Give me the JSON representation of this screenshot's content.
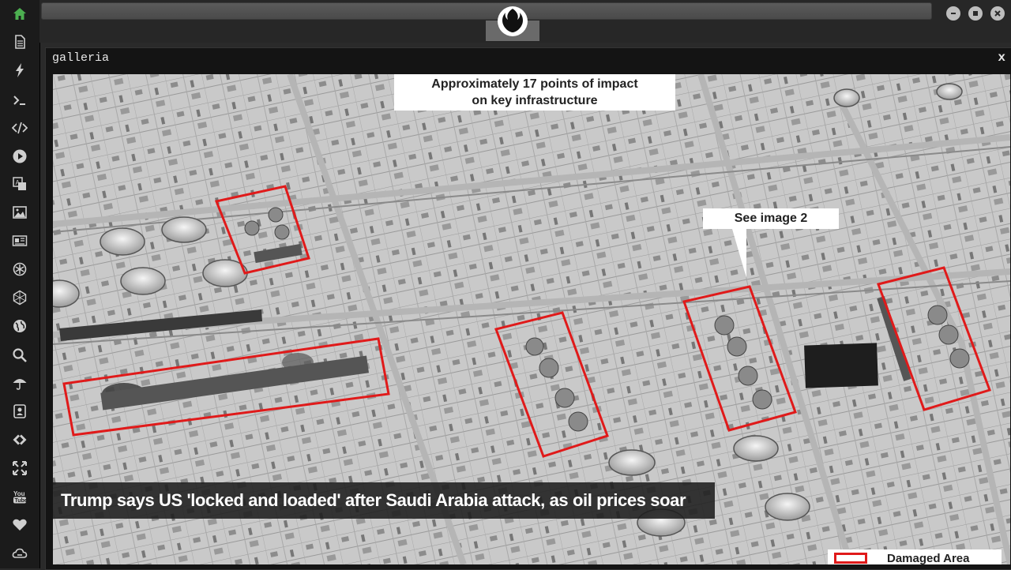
{
  "window": {
    "title": "galleria",
    "close_label": "x"
  },
  "photo": {
    "annotation_top": "Approximately 17 points of impact on key infrastructure",
    "annotation_top_line1": "Approximately 17 points of impact",
    "annotation_top_line2": "on key infrastructure",
    "annotation_see": "See image 2",
    "legend_label": "Damaged Area",
    "caption": "Trump says US 'locked and loaded' after Saudi Arabia attack, as oil prices soar"
  },
  "dock": {
    "items": [
      {
        "name": "home-icon"
      },
      {
        "name": "document-icon"
      },
      {
        "name": "lightning-icon"
      },
      {
        "name": "terminal-icon"
      },
      {
        "name": "code-icon"
      },
      {
        "name": "play-icon"
      },
      {
        "name": "translate-icon"
      },
      {
        "name": "image-icon"
      },
      {
        "name": "newspaper-icon"
      },
      {
        "name": "settings-icon"
      },
      {
        "name": "hexagon-icon"
      },
      {
        "name": "globe-icon"
      },
      {
        "name": "search-icon"
      },
      {
        "name": "umbrella-icon"
      },
      {
        "name": "contact-icon"
      },
      {
        "name": "tag-icon"
      },
      {
        "name": "expand-icon"
      },
      {
        "name": "youtube-icon"
      },
      {
        "name": "heart-icon"
      },
      {
        "name": "cloud-icon"
      }
    ],
    "active_color": "#4caf50",
    "icon_color": "#cfcfcf"
  },
  "colors": {
    "damage_box": "#e01a1a"
  }
}
